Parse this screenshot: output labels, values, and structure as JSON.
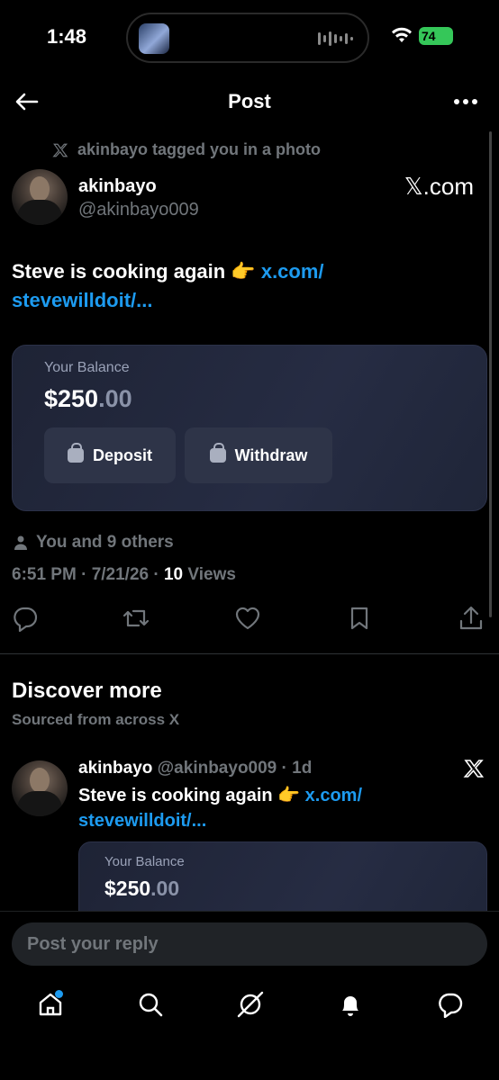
{
  "status": {
    "time": "1:48",
    "battery": "74"
  },
  "header": {
    "title": "Post"
  },
  "post": {
    "tag_text": "akinbayo tagged you in a photo",
    "author_name": "akinbayo",
    "author_handle": "@akinbayo009",
    "source": "𝕏.com",
    "text": "Steve is cooking again 👉",
    "link_line1": "x.com/",
    "link_line2": "stevewilldoit/...",
    "card": {
      "balance_label": "Your Balance",
      "balance_main": "$250",
      "balance_cents": ".00",
      "deposit_label": "Deposit",
      "withdraw_label": "Withdraw"
    },
    "likes": "You and 9 others",
    "timestamp": "6:51 PM · 7/21/26 · ",
    "views_count": "10",
    "views_label": " Views"
  },
  "discover": {
    "title": "Discover more",
    "subtitle": "Sourced from across X",
    "item": {
      "author_name": "akinbayo",
      "author_meta": "@akinbayo009 · 1d",
      "text": "Steve is cooking again 👉",
      "link_line1": "x.com/",
      "link_line2": "stevewilldoit/...",
      "balance_label": "Your Balance",
      "balance_main": "$250",
      "balance_cents": ".00"
    }
  },
  "reply": {
    "placeholder": "Post your reply"
  }
}
